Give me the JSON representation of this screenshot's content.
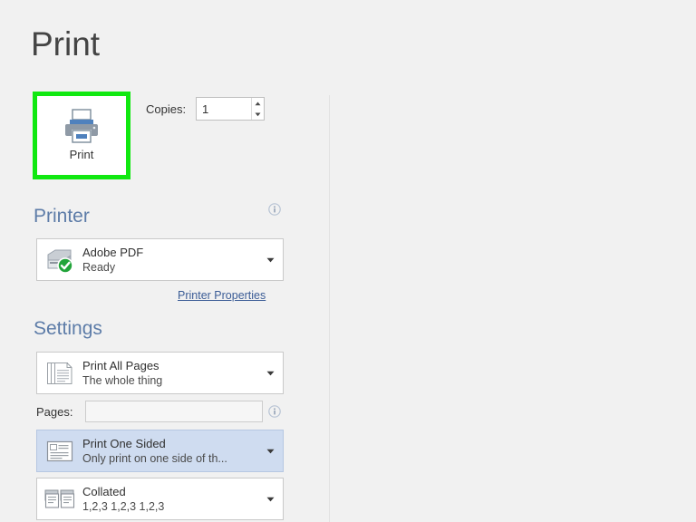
{
  "page": {
    "title": "Print",
    "accent_heading_color": "#5d7ca8",
    "highlight_color": "#10e810",
    "selected_row_color": "#cfdcf0",
    "background_color": "#f1f1f1"
  },
  "print_button": {
    "label": "Print",
    "icon": "printer-icon",
    "highlighted": "true"
  },
  "copies": {
    "label": "Copies:",
    "value": "1",
    "placeholder": "",
    "increment_icon": "spinner-up-icon",
    "decrement_icon": "spinner-down-icon"
  },
  "printer_section": {
    "heading": "Printer",
    "info_icon": "info-icon",
    "combo": {
      "icon": "printer-ready-icon",
      "title": "Adobe PDF",
      "subtitle": "Ready",
      "arrow_icon": "chevron-down-icon"
    },
    "properties_link": "Printer Properties"
  },
  "settings_section": {
    "heading": "Settings",
    "rows": [
      {
        "id": "print-range",
        "icon": "pages-stack-icon",
        "title": "Print All Pages",
        "subtitle": "The whole thing",
        "arrow_icon": "chevron-down-icon",
        "selected": false
      },
      {
        "id": "print-sides",
        "icon": "one-sided-page-icon",
        "title": "Print One Sided",
        "subtitle": "Only print on one side of th...",
        "arrow_icon": "chevron-down-icon",
        "selected": true
      },
      {
        "id": "collation",
        "icon": "collated-pages-icon",
        "title": "Collated",
        "subtitle": "1,2,3   1,2,3   1,2,3",
        "arrow_icon": "chevron-down-icon",
        "selected": false
      }
    ],
    "pages_field": {
      "label": "Pages:",
      "value": "",
      "placeholder": "",
      "info_icon": "info-icon"
    }
  }
}
